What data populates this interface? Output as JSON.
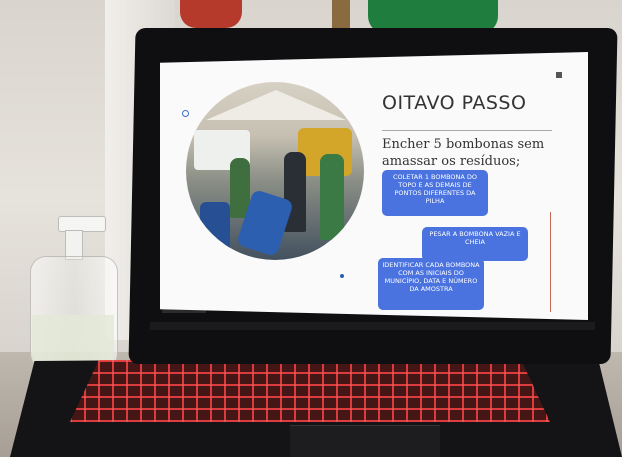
{
  "slide": {
    "title": "OITAVO PASSO",
    "subtitle": "Encher 5 bombonas sem amassar os resíduos;",
    "steps": [
      "COLETAR 1 BOMBONA DO TOPO E AS DEMAIS DE PONTOS DIFERENTES DA PILHA",
      "PESAR A BOMBONA VAZIA E CHEIA",
      "IDENTIFICAR CADA BOMBONA COM AS INICIAIS DO MUNICÍPIO, DATA E NÚMERO DA AMOSTRA"
    ]
  },
  "colors": {
    "step_box": "#4a73e0",
    "keyboard_backlight": "#ff3a3a",
    "flag_green": "#1f7d3e",
    "flag_red": "#b53a2b"
  }
}
